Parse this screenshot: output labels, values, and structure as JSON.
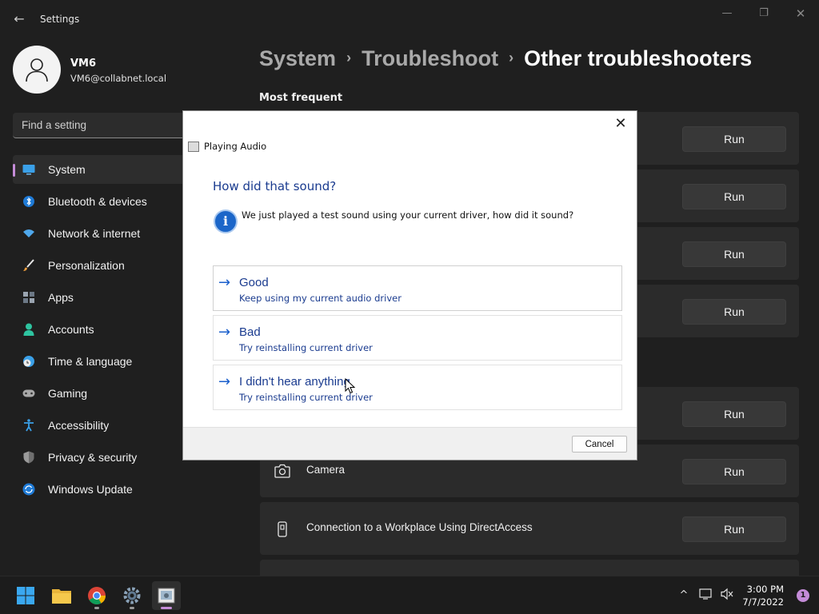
{
  "window": {
    "app_title": "Settings",
    "back_glyph": "←",
    "minimize_glyph": "—",
    "maximize_glyph": "❐",
    "close_glyph": "✕"
  },
  "profile": {
    "name": "VM6",
    "email": "VM6@collabnet.local"
  },
  "search": {
    "placeholder": "Find a setting"
  },
  "sidebar": {
    "items": [
      {
        "label": "System",
        "icon": "monitor-icon",
        "active": true
      },
      {
        "label": "Bluetooth & devices",
        "icon": "bluetooth-icon"
      },
      {
        "label": "Network & internet",
        "icon": "wifi-icon"
      },
      {
        "label": "Personalization",
        "icon": "brush-icon"
      },
      {
        "label": "Apps",
        "icon": "apps-icon"
      },
      {
        "label": "Accounts",
        "icon": "person-icon"
      },
      {
        "label": "Time & language",
        "icon": "clock-globe-icon"
      },
      {
        "label": "Gaming",
        "icon": "gamepad-icon"
      },
      {
        "label": "Accessibility",
        "icon": "accessibility-icon"
      },
      {
        "label": "Privacy & security",
        "icon": "shield-icon"
      },
      {
        "label": "Windows Update",
        "icon": "update-icon"
      }
    ]
  },
  "breadcrumb": {
    "items": [
      "System",
      "Troubleshoot",
      "Other troubleshooters"
    ],
    "separator": "›"
  },
  "main": {
    "section_title": "Most frequent",
    "run_label": "Run",
    "cards": [
      {
        "label": "",
        "icon": ""
      },
      {
        "label": "",
        "icon": ""
      },
      {
        "label": "",
        "icon": ""
      },
      {
        "label": "",
        "icon": ""
      },
      {
        "label": "",
        "icon": ""
      },
      {
        "label": "Camera",
        "icon": "camera-icon"
      },
      {
        "label": "Connection to a Workplace Using DirectAccess",
        "icon": "phone-device-icon"
      }
    ]
  },
  "dialog": {
    "title": "Playing Audio",
    "close_glyph": "✕",
    "heading": "How did that sound?",
    "info_glyph": "i",
    "info_text": "We just played a test sound using your current driver, how did it sound?",
    "arrow_glyph": "→",
    "options": [
      {
        "title": "Good",
        "subtitle": "Keep using my current audio driver"
      },
      {
        "title": "Bad",
        "subtitle": "Try reinstalling current driver"
      },
      {
        "title": "I didn't hear anything",
        "subtitle": "Try reinstalling current driver"
      }
    ],
    "cancel_label": "Cancel"
  },
  "taskbar": {
    "apps": [
      "start-icon",
      "file-explorer-icon",
      "chrome-icon",
      "settings-gear-icon",
      "troubleshooter-icon"
    ],
    "tray_chevron": "^",
    "time": "3:00 PM",
    "date": "7/7/2022",
    "notification_count": "1"
  },
  "colors": {
    "accent": "#c48cd8",
    "dialog_link": "#1a3b8f",
    "info_blue": "#1b66c9"
  }
}
